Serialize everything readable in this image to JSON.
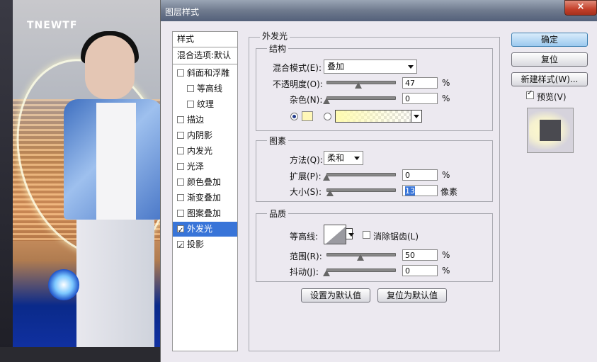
{
  "background": {
    "logo_text": "TNEWTF"
  },
  "window": {
    "title": "图层样式",
    "close_glyph": "×"
  },
  "style_list": {
    "header": "样式",
    "blend_item": "混合选项:默认",
    "items": [
      {
        "label": "斜面和浮雕",
        "checked": false,
        "sub": false
      },
      {
        "label": "等高线",
        "checked": false,
        "sub": true
      },
      {
        "label": "纹理",
        "checked": false,
        "sub": true
      },
      {
        "label": "描边",
        "checked": false,
        "sub": false
      },
      {
        "label": "内阴影",
        "checked": false,
        "sub": false
      },
      {
        "label": "内发光",
        "checked": false,
        "sub": false
      },
      {
        "label": "光泽",
        "checked": false,
        "sub": false
      },
      {
        "label": "颜色叠加",
        "checked": false,
        "sub": false
      },
      {
        "label": "渐变叠加",
        "checked": false,
        "sub": false
      },
      {
        "label": "图案叠加",
        "checked": false,
        "sub": false
      },
      {
        "label": "外发光",
        "checked": true,
        "sub": false,
        "selected": true
      },
      {
        "label": "投影",
        "checked": true,
        "sub": false
      }
    ]
  },
  "panel": {
    "title": "外发光",
    "structure": {
      "title": "结构",
      "blend_mode_label": "混合模式(E):",
      "blend_mode_value": "叠加",
      "opacity_label": "不透明度(O):",
      "opacity_value": "47",
      "opacity_fraction": 0.47,
      "noise_label": "杂色(N):",
      "noise_value": "0",
      "noise_fraction": 0,
      "percent": "%",
      "glow_color": "#fff7b8"
    },
    "elements": {
      "title": "图素",
      "method_label": "方法(Q):",
      "method_value": "柔和",
      "spread_label": "扩展(P):",
      "spread_value": "0",
      "spread_fraction": 0,
      "size_label": "大小(S):",
      "size_value": "13",
      "size_fraction": 0.05,
      "size_unit": "像素",
      "percent": "%"
    },
    "quality": {
      "title": "品质",
      "contour_label": "等高线:",
      "antialias_label": "消除锯齿(L)",
      "antialias_checked": false,
      "range_label": "范围(R):",
      "range_value": "50",
      "range_fraction": 0.5,
      "jitter_label": "抖动(J):",
      "jitter_value": "0",
      "jitter_fraction": 0,
      "percent": "%"
    },
    "make_default": "设置为默认值",
    "reset_default": "复位为默认值"
  },
  "buttons": {
    "ok": "确定",
    "reset": "复位",
    "new_style": "新建样式(W)...",
    "preview_label": "预览(V)",
    "preview_checked": true
  }
}
